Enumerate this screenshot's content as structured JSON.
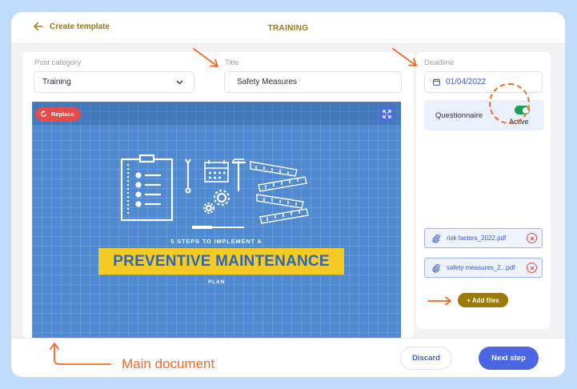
{
  "header": {
    "back_label": "Create template",
    "title": "TRAINING"
  },
  "form": {
    "post_category": {
      "label": "Post category",
      "value": "Training"
    },
    "title": {
      "label": "Title",
      "value": "Safety Measures"
    },
    "deadline": {
      "label": "Deadline",
      "value": "01/04/2022"
    }
  },
  "media": {
    "replace_label": "Replace",
    "poster": {
      "subtitle": "5 STEPS TO IMPLEMENT A",
      "headline": "PREVENTIVE MAINTENANCE",
      "footer": "PLAN"
    }
  },
  "questionnaire": {
    "label": "Questionnaire",
    "status": "Active",
    "enabled": true
  },
  "attachments": [
    {
      "name": "risk factors_2022.pdf"
    },
    {
      "name": "safety measures_2...pdf"
    }
  ],
  "add_files_label": "+ Add files",
  "footer": {
    "discard_label": "Discard",
    "next_label": "Next step"
  },
  "annotation": {
    "label": "Main document"
  },
  "colors": {
    "accent_gold": "#9a7a0b",
    "primary_blue": "#4b66e2",
    "annotation_orange": "#f06a23",
    "danger_red": "#e24a4a",
    "poster_blue": "#4f8ad0",
    "banner_yellow": "#f4cb24"
  }
}
